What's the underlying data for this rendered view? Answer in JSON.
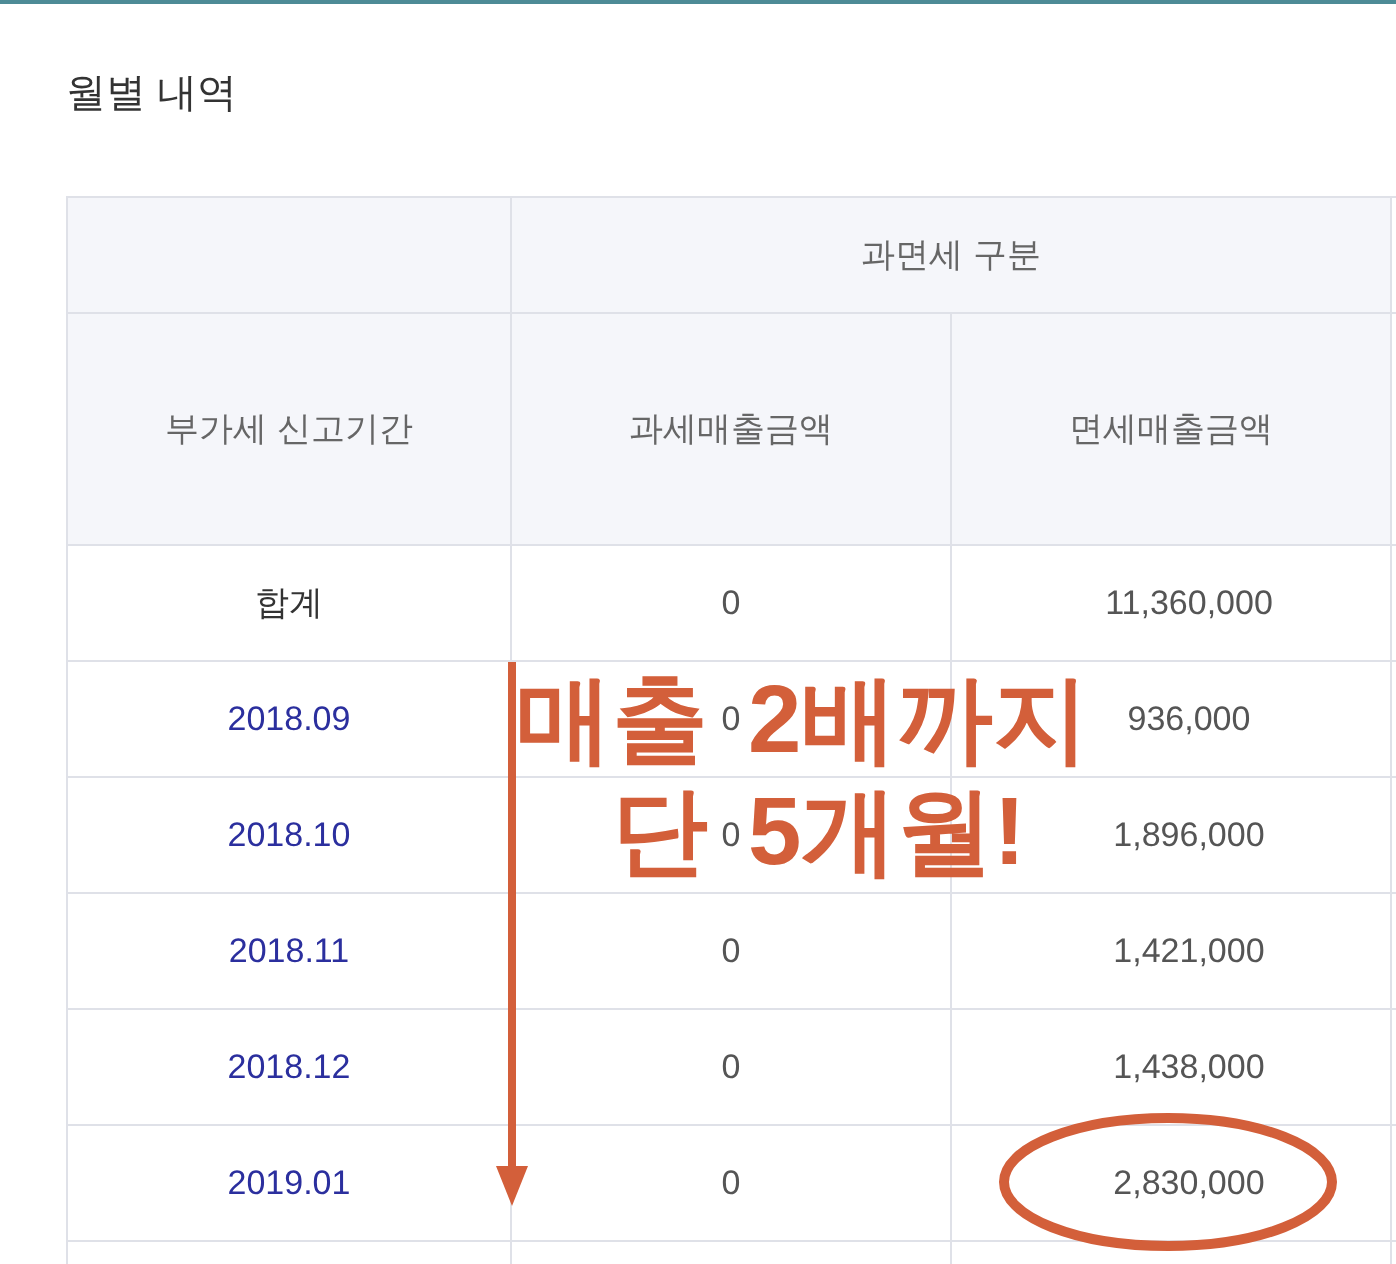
{
  "section_title": "월별 내역",
  "table": {
    "group_header": "과면세 구분",
    "columns": [
      "부가세 신고기간",
      "과세매출금액",
      "면세매출금액"
    ],
    "rows": [
      {
        "kind": "total",
        "period": "합계",
        "taxable": "0",
        "exempt": "11,360,000",
        "circled": false
      },
      {
        "kind": "month",
        "period": "2018.09",
        "taxable": "0",
        "exempt": "936,000",
        "circled": false
      },
      {
        "kind": "month",
        "period": "2018.10",
        "taxable": "0",
        "exempt": "1,896,000",
        "circled": false
      },
      {
        "kind": "month",
        "period": "2018.11",
        "taxable": "0",
        "exempt": "1,421,000",
        "circled": false
      },
      {
        "kind": "month",
        "period": "2018.12",
        "taxable": "0",
        "exempt": "1,438,000",
        "circled": false
      },
      {
        "kind": "month",
        "period": "2019.01",
        "taxable": "0",
        "exempt": "2,830,000",
        "circled": true
      }
    ]
  },
  "annotation": {
    "lines": [
      [
        "매출",
        "2배까지"
      ],
      [
        "단",
        "5개월!"
      ]
    ]
  }
}
